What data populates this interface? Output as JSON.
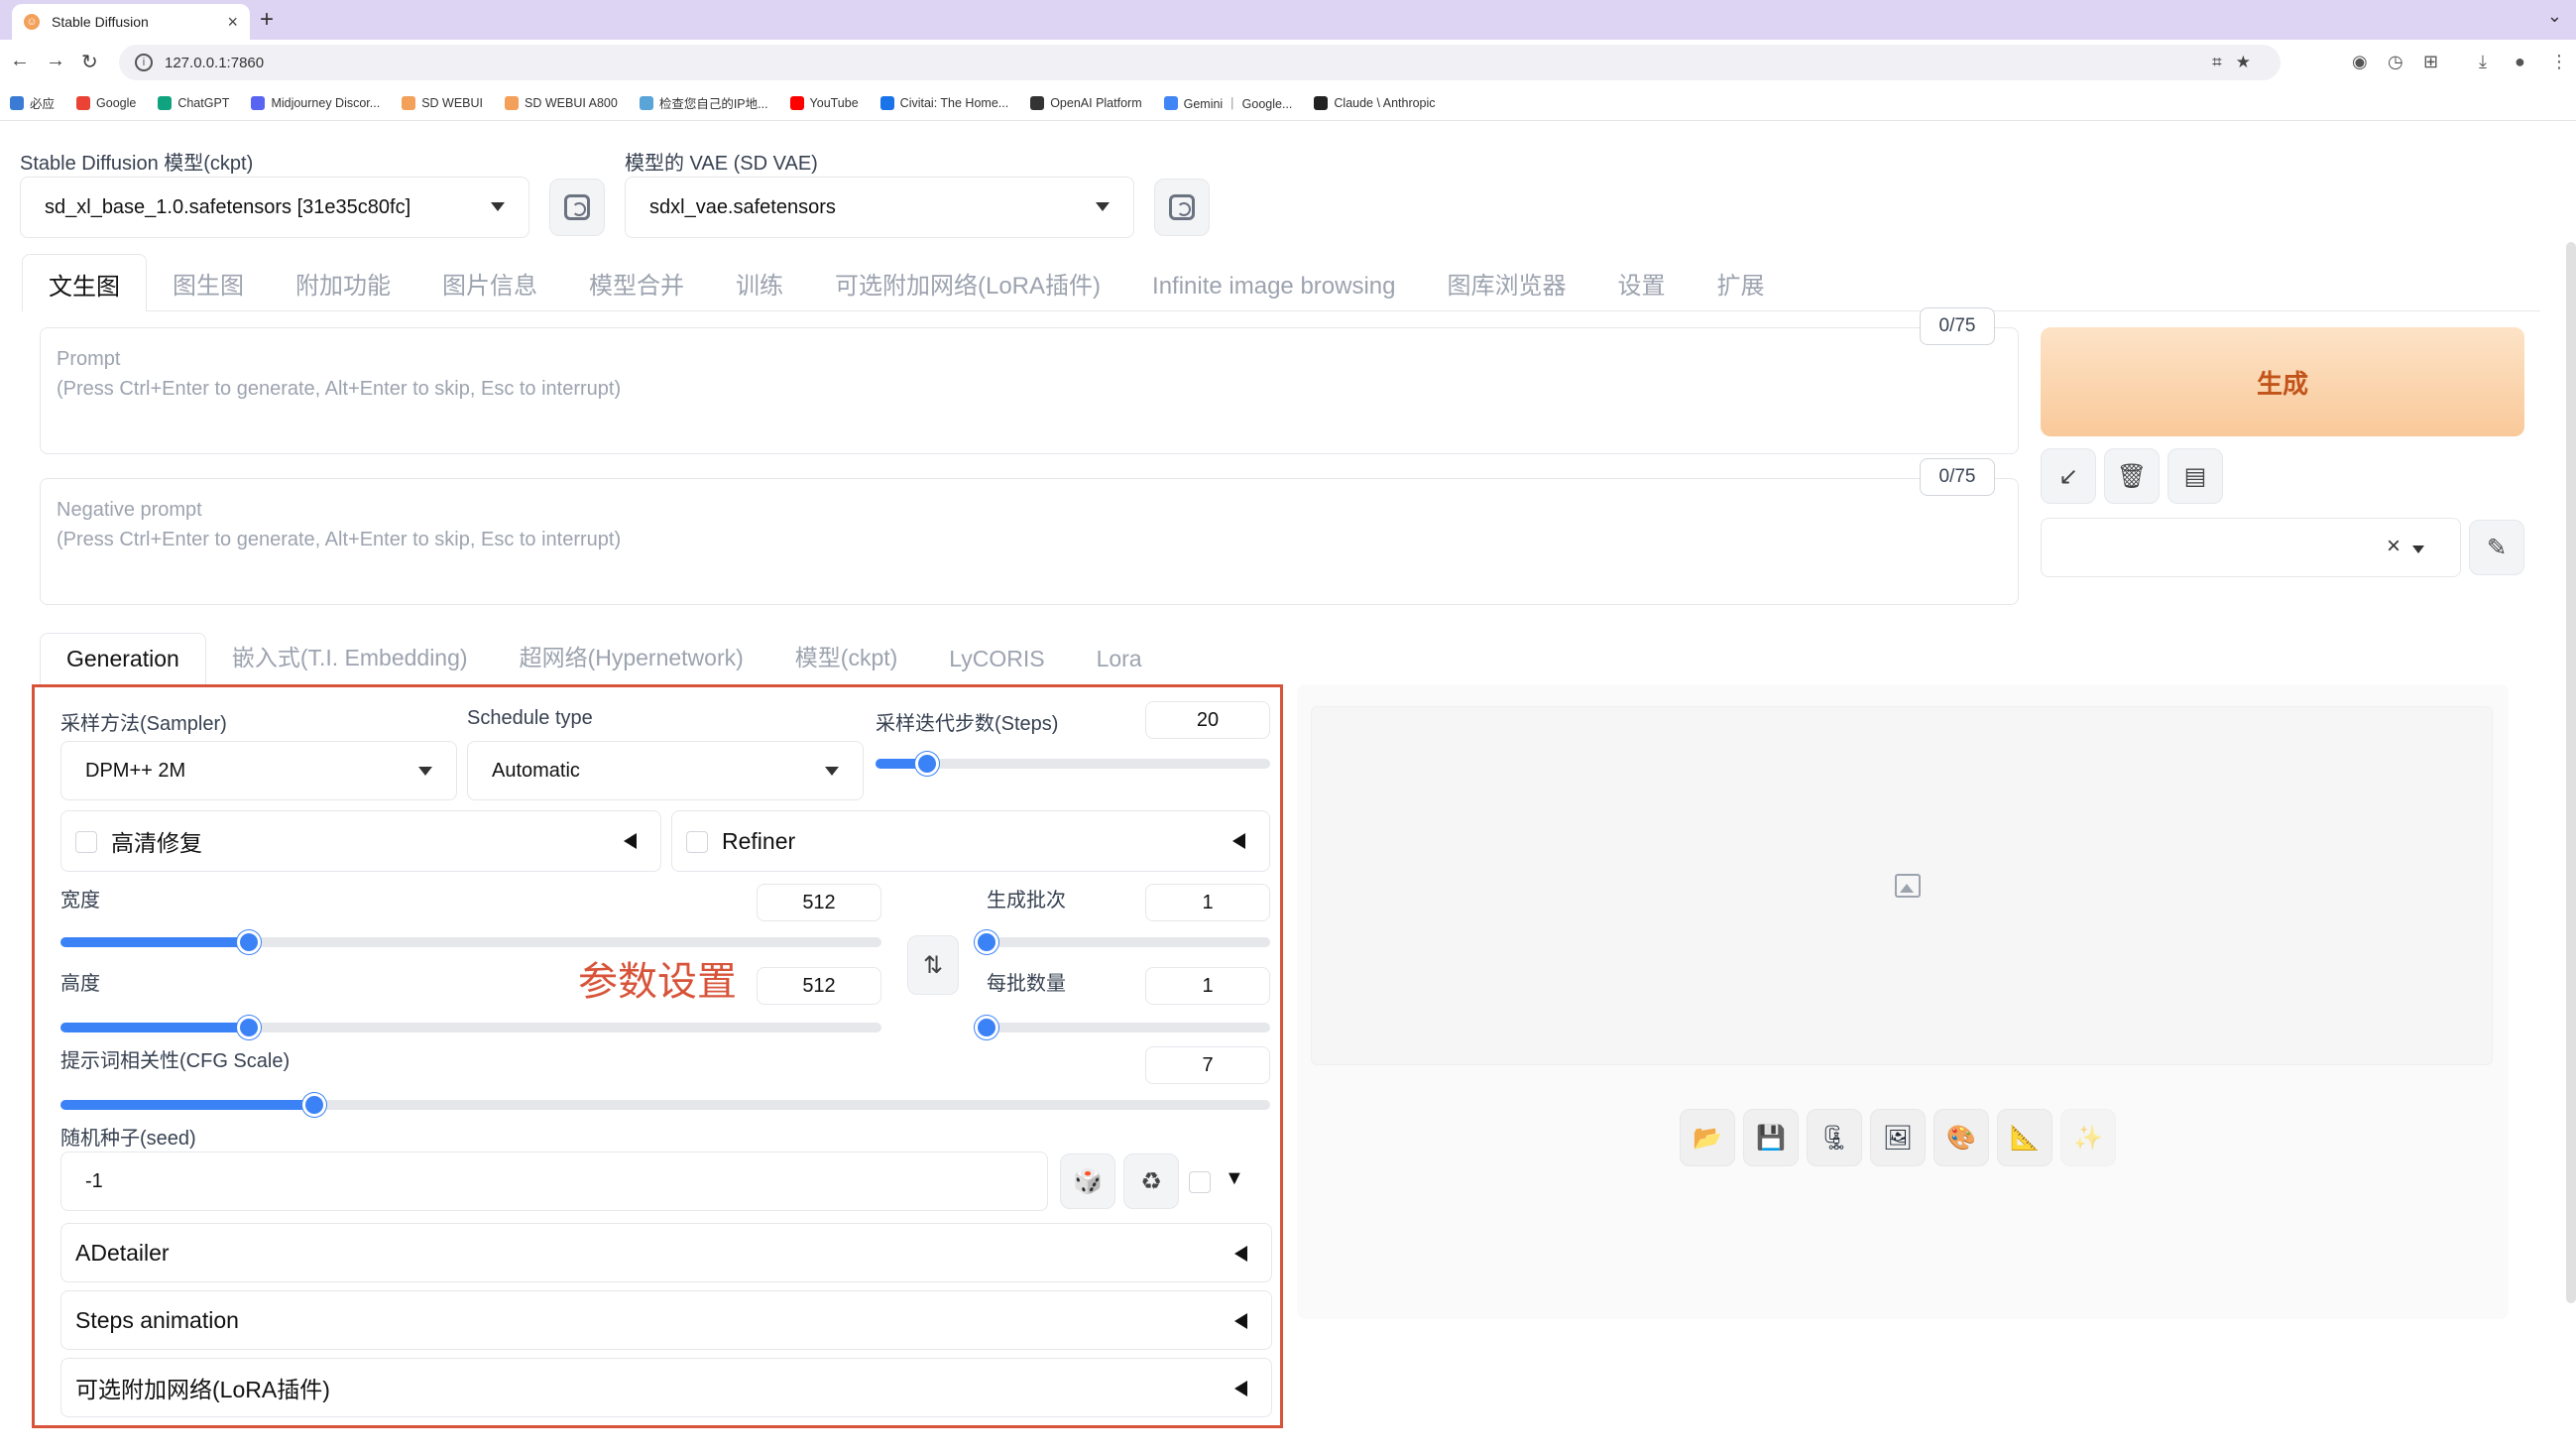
{
  "browser": {
    "tab_title": "Stable Diffusion",
    "new_tab": "+",
    "url": "127.0.0.1:7860",
    "bookmarks": [
      {
        "label": "必应",
        "color": "#3a7bd5"
      },
      {
        "label": "Google",
        "color": "#ea4335"
      },
      {
        "label": "ChatGPT",
        "color": "#10a37f"
      },
      {
        "label": "Midjourney Discor...",
        "color": "#5865f2"
      },
      {
        "label": "SD WEBUI",
        "color": "#f3a05a"
      },
      {
        "label": "SD WEBUI A800",
        "color": "#f3a05a"
      },
      {
        "label": "检查您自己的IP地...",
        "color": "#59a5d8"
      },
      {
        "label": "YouTube",
        "color": "#ff0000"
      },
      {
        "label": "Civitai: The Home...",
        "color": "#1a73e8"
      },
      {
        "label": "OpenAI Platform",
        "color": "#333333"
      },
      {
        "label": "Gemini ｜ Google...",
        "color": "#4285f4"
      },
      {
        "label": "Claude \\ Anthropic",
        "color": "#222222"
      }
    ]
  },
  "header": {
    "ckpt_label": "Stable Diffusion 模型(ckpt)",
    "ckpt_value": "sd_xl_base_1.0.safetensors [31e35c80fc]",
    "vae_label": "模型的 VAE (SD VAE)",
    "vae_value": "sdxl_vae.safetensors"
  },
  "main_tabs": [
    "文生图",
    "图生图",
    "附加功能",
    "图片信息",
    "模型合并",
    "训练",
    "可选附加网络(LoRA插件)",
    "Infinite image browsing",
    "图库浏览器",
    "设置",
    "扩展"
  ],
  "prompt": {
    "title": "Prompt",
    "hint": "(Press Ctrl+Enter to generate, Alt+Enter to skip, Esc to interrupt)",
    "counter": "0/75"
  },
  "negative_prompt": {
    "title": "Negative prompt",
    "hint": "(Press Ctrl+Enter to generate, Alt+Enter to skip, Esc to interrupt)",
    "counter": "0/75"
  },
  "generate_label": "生成",
  "style_clear": "×",
  "sub_tabs": [
    "Generation",
    "嵌入式(T.I. Embedding)",
    "超网络(Hypernetwork)",
    "模型(ckpt)",
    "LyCORIS",
    "Lora"
  ],
  "params": {
    "sampler_label": "采样方法(Sampler)",
    "sampler_value": "DPM++ 2M",
    "schedule_label": "Schedule type",
    "schedule_value": "Automatic",
    "steps_label": "采样迭代步数(Steps)",
    "steps_value": "20",
    "steps_fraction": 0.13,
    "hires_label": "高清修复",
    "refiner_label": "Refiner",
    "width_label": "宽度",
    "width_value": "512",
    "width_fraction": 0.23,
    "height_label": "高度",
    "height_value": "512",
    "height_fraction": 0.23,
    "batch_count_label": "生成批次",
    "batch_count_value": "1",
    "batch_count_fraction": 0.0,
    "batch_size_label": "每批数量",
    "batch_size_value": "1",
    "batch_size_fraction": 0.0,
    "cfg_label": "提示词相关性(CFG Scale)",
    "cfg_value": "7",
    "cfg_fraction": 0.21,
    "seed_label": "随机种子(seed)",
    "seed_value": "-1",
    "annotation": "参数设置",
    "accordions": [
      "ADetailer",
      "Steps animation",
      "可选附加网络(LoRA插件)"
    ]
  },
  "icons": {
    "swap": "⇅",
    "dice": "🎲",
    "recycle": "♻",
    "extra_toggle": "▼",
    "paste": "↙",
    "trash": "🗑",
    "clipboard": "▤",
    "edit": "✎",
    "output_buttons": [
      "📂",
      "💾",
      "🗜",
      "🖼",
      "🎨",
      "📐",
      "✨"
    ]
  },
  "colors": {
    "accent": "#3b82f6",
    "annotation": "#d75339",
    "generate_text": "#c2541a"
  }
}
